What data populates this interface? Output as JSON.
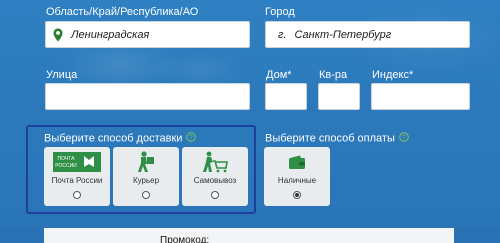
{
  "region": {
    "label": "Область/Край/Республика/АО",
    "value": "Ленинградская"
  },
  "city": {
    "label": "Город",
    "prefix": "г.",
    "value": "Санкт-Петербург"
  },
  "street": {
    "label": "Улица",
    "value": ""
  },
  "house": {
    "label": "Дом*",
    "value": ""
  },
  "apartment": {
    "label": "Кв-ра",
    "value": ""
  },
  "postcode": {
    "label": "Индекс*",
    "value": ""
  },
  "delivery": {
    "title": "Выберите способ доставки",
    "options": [
      {
        "label": "Почта России",
        "logo_text_1": "ПОЧТА",
        "logo_text_2": "РОССИИ",
        "icon": "russian-post-logo",
        "selected": false
      },
      {
        "label": "Курьер",
        "icon": "courier-icon",
        "selected": false
      },
      {
        "label": "Самовывоз",
        "icon": "pickup-cart-icon",
        "selected": false
      }
    ]
  },
  "payment": {
    "title": "Выберите способ оплаты",
    "options": [
      {
        "label": "Наличные",
        "icon": "wallet-icon",
        "selected": true
      }
    ]
  },
  "promo": {
    "label": "Промокод:"
  },
  "colors": {
    "background": "#2b79bb",
    "highlight_border": "#1e3f9e",
    "pin": "#2e7d32",
    "icon_green": "#2f8f46"
  }
}
